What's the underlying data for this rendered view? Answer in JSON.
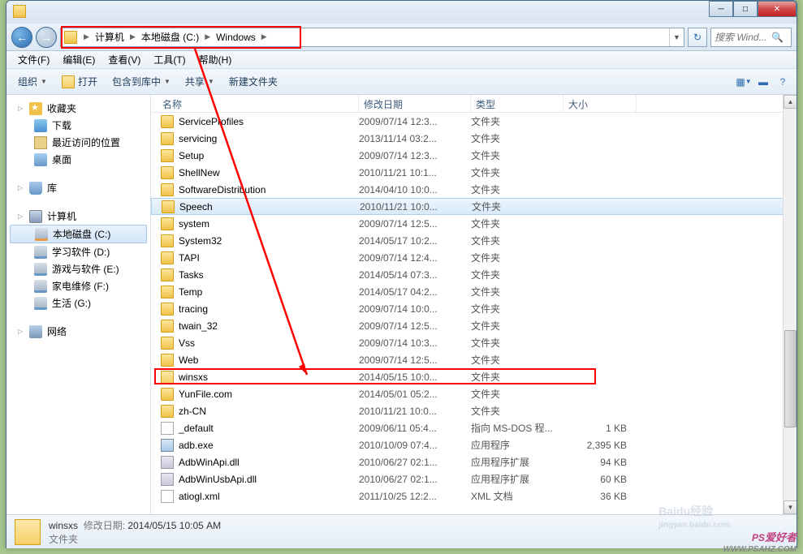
{
  "breadcrumb": {
    "p1": "计算机",
    "p2": "本地磁盘 (C:)",
    "p3": "Windows"
  },
  "search": {
    "placeholder": "搜索 Wind..."
  },
  "menus": {
    "file": "文件(F)",
    "edit": "编辑(E)",
    "view": "查看(V)",
    "tools": "工具(T)",
    "help": "帮助(H)"
  },
  "toolbar": {
    "org": "组织",
    "open": "打开",
    "include": "包含到库中",
    "share": "共享",
    "newfolder": "新建文件夹"
  },
  "sidebar": {
    "fav": "收藏夹",
    "dl": "下载",
    "recent": "最近访问的位置",
    "desk": "桌面",
    "lib": "库",
    "comp": "计算机",
    "c": "本地磁盘 (C:)",
    "d": "学习软件 (D:)",
    "e": "游戏与软件 (E:)",
    "f": "家电维修 (F:)",
    "g": "生活 (G:)",
    "net": "网络"
  },
  "cols": {
    "name": "名称",
    "date": "修改日期",
    "type": "类型",
    "size": "大小"
  },
  "types": {
    "folder": "文件夹",
    "bat": "指向 MS-DOS 程...",
    "exe": "应用程序",
    "dll": "应用程序扩展",
    "xml": "XML 文档"
  },
  "rows": [
    {
      "n": "ServiceProfiles",
      "d": "2009/07/14 12:3...",
      "t": "folder",
      "i": "folder"
    },
    {
      "n": "servicing",
      "d": "2013/11/14 03:2...",
      "t": "folder",
      "i": "folder"
    },
    {
      "n": "Setup",
      "d": "2009/07/14 12:3...",
      "t": "folder",
      "i": "folder"
    },
    {
      "n": "ShellNew",
      "d": "2010/11/21 10:1...",
      "t": "folder",
      "i": "folder"
    },
    {
      "n": "SoftwareDistribution",
      "d": "2014/04/10 10:0...",
      "t": "folder",
      "i": "folder"
    },
    {
      "n": "Speech",
      "d": "2010/11/21 10:0...",
      "t": "folder",
      "i": "folder",
      "sel": true
    },
    {
      "n": "system",
      "d": "2009/07/14 12:5...",
      "t": "folder",
      "i": "folder"
    },
    {
      "n": "System32",
      "d": "2014/05/17 10:2...",
      "t": "folder",
      "i": "folder"
    },
    {
      "n": "TAPI",
      "d": "2009/07/14 12:4...",
      "t": "folder",
      "i": "folder"
    },
    {
      "n": "Tasks",
      "d": "2014/05/14 07:3...",
      "t": "folder",
      "i": "folder"
    },
    {
      "n": "Temp",
      "d": "2014/05/17 04:2...",
      "t": "folder",
      "i": "folder"
    },
    {
      "n": "tracing",
      "d": "2009/07/14 10:0...",
      "t": "folder",
      "i": "folder"
    },
    {
      "n": "twain_32",
      "d": "2009/07/14 12:5...",
      "t": "folder",
      "i": "folder"
    },
    {
      "n": "Vss",
      "d": "2009/07/14 10:3...",
      "t": "folder",
      "i": "folder"
    },
    {
      "n": "Web",
      "d": "2009/07/14 12:5...",
      "t": "folder",
      "i": "folder"
    },
    {
      "n": "winsxs",
      "d": "2014/05/15 10:0...",
      "t": "folder",
      "i": "folder-open"
    },
    {
      "n": "YunFile.com",
      "d": "2014/05/01 05:2...",
      "t": "folder",
      "i": "folder"
    },
    {
      "n": "zh-CN",
      "d": "2010/11/21 10:0...",
      "t": "folder",
      "i": "folder"
    },
    {
      "n": "_default",
      "d": "2009/06/11 05:4...",
      "t": "bat",
      "i": "file",
      "s": "1 KB"
    },
    {
      "n": "adb.exe",
      "d": "2010/10/09 07:4...",
      "t": "exe",
      "i": "exe",
      "s": "2,395 KB"
    },
    {
      "n": "AdbWinApi.dll",
      "d": "2010/06/27 02:1...",
      "t": "dll",
      "i": "dll",
      "s": "94 KB"
    },
    {
      "n": "AdbWinUsbApi.dll",
      "d": "2010/06/27 02:1...",
      "t": "dll",
      "i": "dll",
      "s": "60 KB"
    },
    {
      "n": "atiogl.xml",
      "d": "2011/10/25 12:2...",
      "t": "xml",
      "i": "xml",
      "s": "36 KB"
    }
  ],
  "status": {
    "name": "winsxs",
    "date_label": "修改日期:",
    "date": "2014/05/15 10:05 AM",
    "type": "文件夹"
  },
  "watermark": {
    "baidu": "Baidu",
    "jy": "经验",
    "sub": "jingyan.baidu.com",
    "ps1": "PS",
    "ps2": "爱好者",
    "psurl": "WWW.PSAHZ.COM"
  }
}
